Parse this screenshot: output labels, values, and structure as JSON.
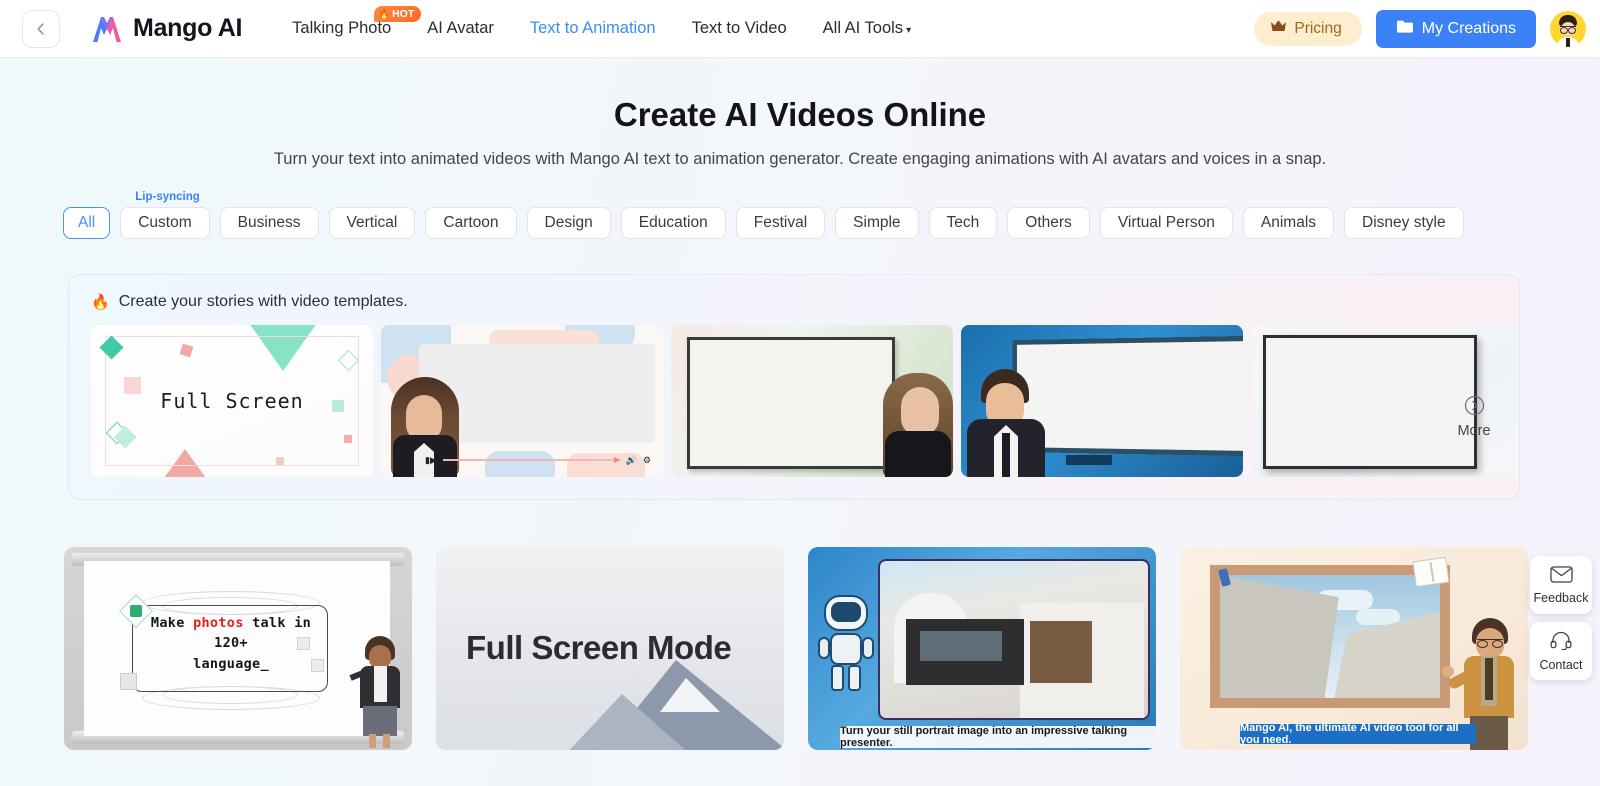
{
  "header": {
    "back_icon": "chevron-left-icon",
    "brand": "Mango AI",
    "nav": [
      {
        "label": "Talking Photo",
        "badge": "HOT",
        "badge_icon": "flame-icon",
        "active": false
      },
      {
        "label": "AI Avatar",
        "active": false
      },
      {
        "label": "Text to Animation",
        "active": true
      },
      {
        "label": "Text to Video",
        "active": false
      },
      {
        "label": "All AI Tools",
        "caret": "▾",
        "active": false
      }
    ],
    "pricing": {
      "label": "Pricing",
      "icon": "crown-icon"
    },
    "creations": {
      "label": "My Creations",
      "icon": "folder-icon"
    },
    "avatar": "user-avatar"
  },
  "hero": {
    "title": "Create AI Videos Online",
    "subtitle": "Turn your text into animated videos with Mango AI text to animation generator. Create engaging animations with AI avatars and voices in a snap."
  },
  "filters": {
    "items": [
      {
        "label": "All",
        "active": true
      },
      {
        "label": "Custom",
        "badge": "Lip-syncing"
      },
      {
        "label": "Business"
      },
      {
        "label": "Vertical"
      },
      {
        "label": "Cartoon"
      },
      {
        "label": "Design"
      },
      {
        "label": "Education"
      },
      {
        "label": "Festival"
      },
      {
        "label": "Simple"
      },
      {
        "label": "Tech"
      },
      {
        "label": "Others"
      },
      {
        "label": "Virtual Person"
      },
      {
        "label": "Animals"
      },
      {
        "label": "Disney style"
      }
    ]
  },
  "banner": {
    "icon": "fire-icon",
    "heading": "Create your stories with video templates.",
    "more_label": "More",
    "more_icon": "chevron-right-circle-icon",
    "cards": [
      {
        "name": "full-screen-geometric",
        "text": "Full Screen"
      },
      {
        "name": "woman-video-player",
        "text": ""
      },
      {
        "name": "whiteboard-woman",
        "text": ""
      },
      {
        "name": "man-blue-screen",
        "text": ""
      },
      {
        "name": "plain-whiteboard",
        "text": ""
      }
    ]
  },
  "grid": {
    "cards": [
      {
        "name": "photos-talk-template",
        "line1_a": "Make ",
        "line1_hl": "photos",
        "line1_b": " talk in 120+",
        "line2": "language_"
      },
      {
        "name": "full-screen-mode-template",
        "title": "Full Screen Mode"
      },
      {
        "name": "robot-architecture-template",
        "caption": "Turn your still portrait image into an impressive talking presenter."
      },
      {
        "name": "castle-education-template",
        "caption": "Mango AI, the ultimate AI video tool for all you need."
      }
    ]
  },
  "floats": [
    {
      "label": "Feedback",
      "icon": "envelope-icon"
    },
    {
      "label": "Contact",
      "icon": "headset-icon"
    }
  ],
  "colors": {
    "accent_blue": "#3b82f6",
    "link_blue": "#3b8df6",
    "pricing_bg": "#fdeecf",
    "pricing_text": "#9a6a18",
    "hot_orange": "#fb6a26",
    "highlight_red": "#e32020"
  }
}
